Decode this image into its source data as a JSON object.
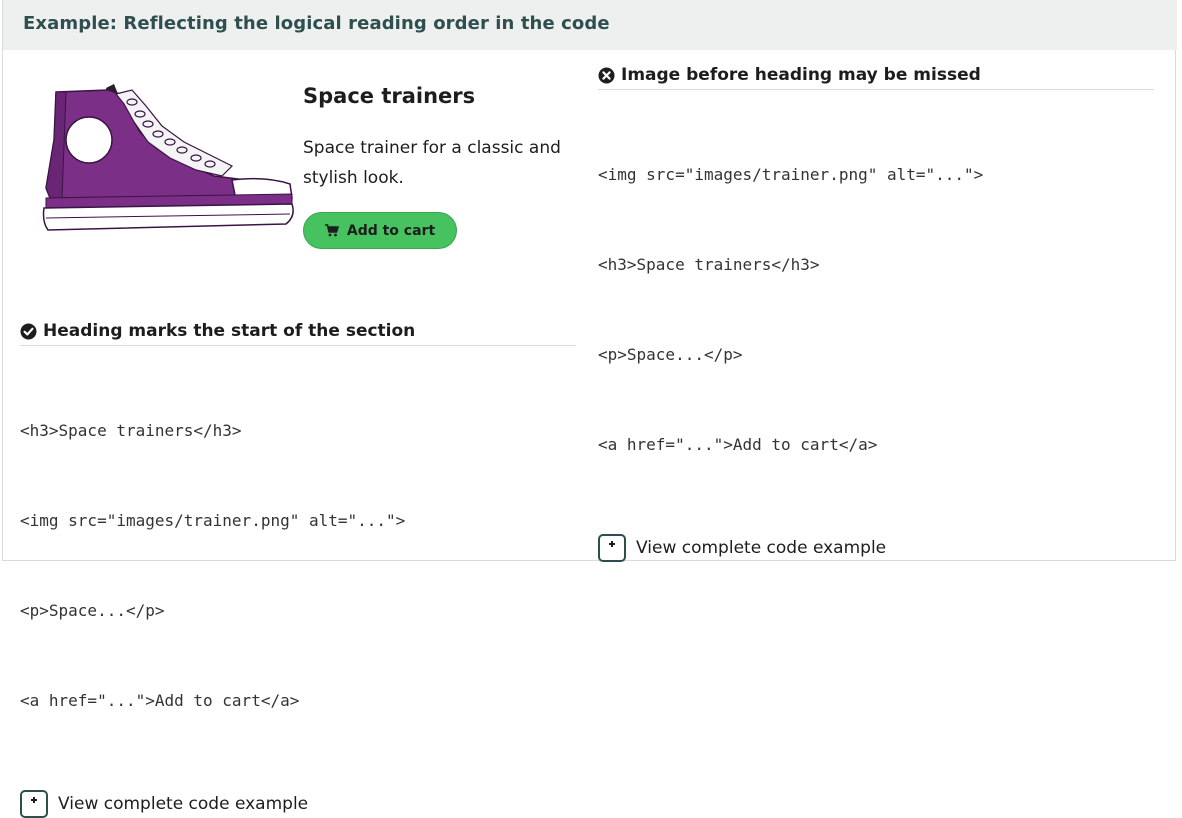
{
  "panel": {
    "title": "Example: Reflecting the logical reading order in the code"
  },
  "product": {
    "image_alt": "purple high-top sneaker",
    "title": "Space trainers",
    "description": "Space trainer for a classic and stylish look.",
    "cart_label": "Add to cart"
  },
  "good_example": {
    "icon": "check-circle-icon",
    "heading": "Heading marks the start of the section",
    "code": [
      "<h3>Space trainers</h3>",
      "<img src=\"images/trainer.png\" alt=\"...\">",
      "<p>Space...</p>",
      "<a href=\"...\">Add to cart</a>"
    ],
    "toggle_label": "View complete code example"
  },
  "bad_example": {
    "icon": "x-circle-icon",
    "heading": "Image before heading may be missed",
    "code": [
      "<img src=\"images/trainer.png\" alt=\"...\">",
      "<h3>Space trainers</h3>",
      "<p>Space...</p>",
      "<a href=\"...\">Add to cart</a>"
    ],
    "toggle_label": "View complete code example"
  },
  "colors": {
    "header_bg": "#eef0f0",
    "title_text": "#2f4f4f",
    "button_green": "#46c35f",
    "shoe_purple": "#7b2f86"
  }
}
